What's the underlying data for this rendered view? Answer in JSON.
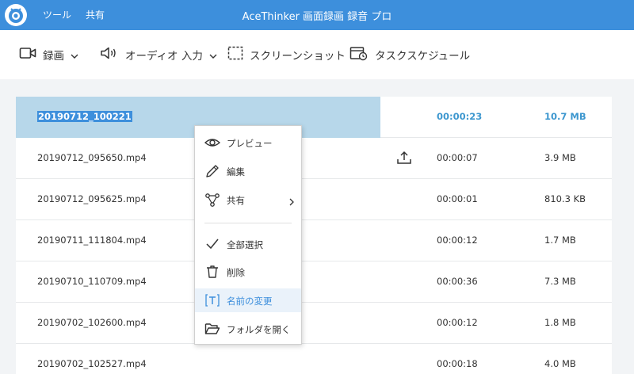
{
  "titlebar": {
    "menu_tools": "ツール",
    "menu_share": "共有",
    "app_title": "AceThinker 画面録画 録音 プロ"
  },
  "toolbar": {
    "record": "録画",
    "audio": "オーディオ 入力",
    "screenshot": "スクリーンショット",
    "schedule": "タスクスケジュール"
  },
  "files": [
    {
      "name": "20190712_100221",
      "duration": "00:00:23",
      "size": "10.7 MB"
    },
    {
      "name": "20190712_095650.mp4",
      "duration": "00:00:07",
      "size": "3.9 MB"
    },
    {
      "name": "20190712_095625.mp4",
      "duration": "00:00:01",
      "size": "810.3 KB"
    },
    {
      "name": "20190711_111804.mp4",
      "duration": "00:00:12",
      "size": "1.7 MB"
    },
    {
      "name": "20190710_110709.mp4",
      "duration": "00:00:36",
      "size": "7.3 MB"
    },
    {
      "name": "20190702_102600.mp4",
      "duration": "00:00:12",
      "size": "1.8 MB"
    },
    {
      "name": "20190702_102527.mp4",
      "duration": "00:00:18",
      "size": "4.0 MB"
    }
  ],
  "context_menu": {
    "preview": "プレビュー",
    "edit": "編集",
    "share": "共有",
    "select_all": "全部選択",
    "delete": "削除",
    "rename": "名前の変更",
    "open_folder": "フォルダを開く"
  },
  "colors": {
    "accent": "#3d8fdc",
    "selection": "#b7d7ea",
    "size_highlight": "#3d97cf"
  },
  "icons": {
    "logo": "app-logo-icon",
    "record": "video-camera-icon",
    "audio": "speaker-icon",
    "screenshot": "crop-frame-icon",
    "schedule": "calendar-clock-icon",
    "upload": "upload-icon"
  }
}
